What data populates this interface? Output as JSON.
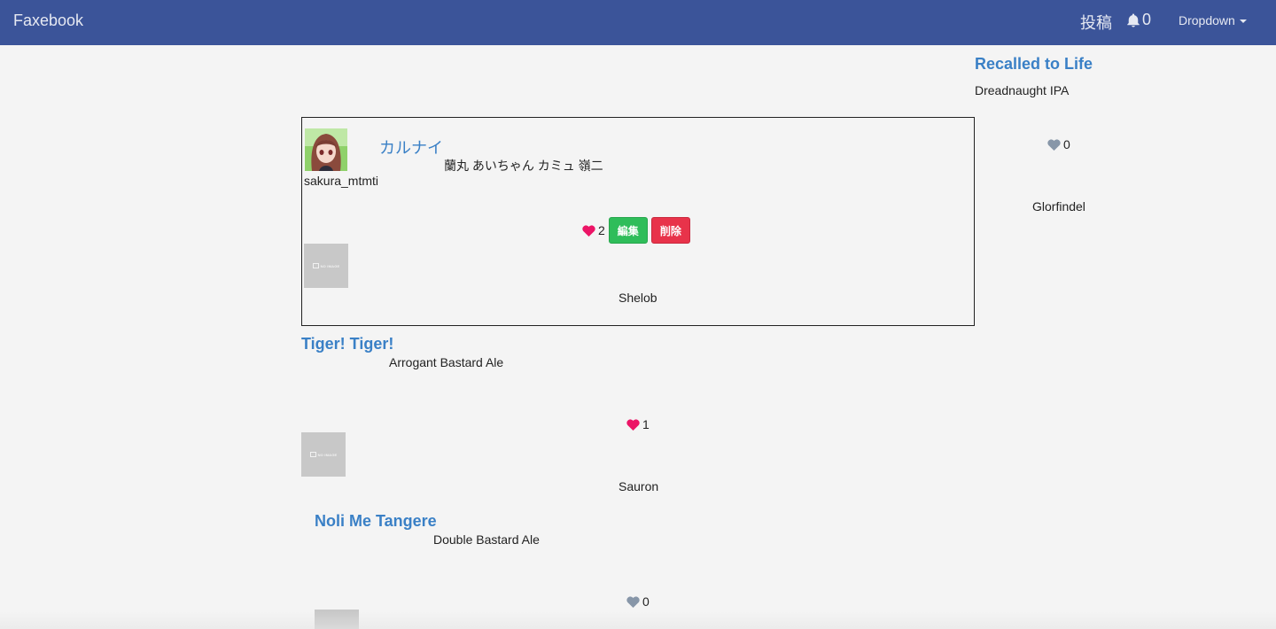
{
  "navbar": {
    "brand": "Faxebook",
    "post_label": "投稿",
    "notification_count": "0",
    "dropdown_label": "Dropdown"
  },
  "colors": {
    "navbar_bg": "#3b5499",
    "link": "#3a80c6",
    "heart_liked": "#ec1466",
    "heart_unliked": "#8796a8",
    "edit_button": "#2fbd5a",
    "delete_button": "#e8334a"
  },
  "no_image_text": "NO IMAGE",
  "sidebar_post": {
    "title": "Recalled to Life",
    "subtitle": "Dreadnaught IPA",
    "likes": "0",
    "liked": false,
    "author": "Glorfindel"
  },
  "featured_post": {
    "title": "カルナイ",
    "body": "蘭丸 あいちゃん カミュ 嶺二",
    "username": "sakura_mtmti",
    "likes": "2",
    "liked": true,
    "edit_label": "編集",
    "delete_label": "削除",
    "author": "Shelob"
  },
  "posts": [
    {
      "title": "Tiger! Tiger!",
      "subtitle": "Arrogant Bastard Ale",
      "likes": "1",
      "liked": true,
      "author": "Sauron"
    },
    {
      "title": "Noli Me Tangere",
      "subtitle": "Double Bastard Ale",
      "likes": "0",
      "liked": false,
      "author": ""
    }
  ]
}
